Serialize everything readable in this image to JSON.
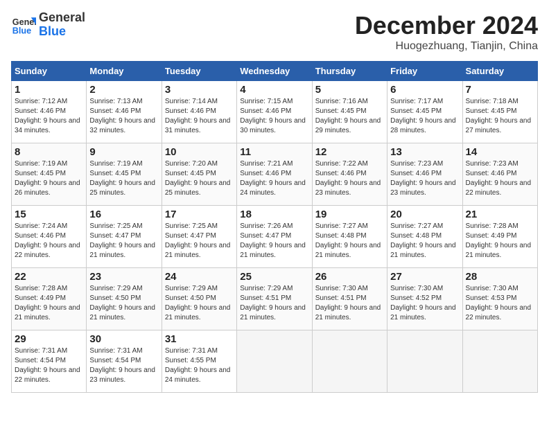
{
  "logo": {
    "line1": "General",
    "line2": "Blue"
  },
  "title": "December 2024",
  "location": "Huogezhuang, Tianjin, China",
  "days_of_week": [
    "Sunday",
    "Monday",
    "Tuesday",
    "Wednesday",
    "Thursday",
    "Friday",
    "Saturday"
  ],
  "weeks": [
    [
      {
        "day": "1",
        "sunrise": "7:12 AM",
        "sunset": "4:46 PM",
        "daylight": "9 hours and 34 minutes."
      },
      {
        "day": "2",
        "sunrise": "7:13 AM",
        "sunset": "4:46 PM",
        "daylight": "9 hours and 32 minutes."
      },
      {
        "day": "3",
        "sunrise": "7:14 AM",
        "sunset": "4:46 PM",
        "daylight": "9 hours and 31 minutes."
      },
      {
        "day": "4",
        "sunrise": "7:15 AM",
        "sunset": "4:46 PM",
        "daylight": "9 hours and 30 minutes."
      },
      {
        "day": "5",
        "sunrise": "7:16 AM",
        "sunset": "4:45 PM",
        "daylight": "9 hours and 29 minutes."
      },
      {
        "day": "6",
        "sunrise": "7:17 AM",
        "sunset": "4:45 PM",
        "daylight": "9 hours and 28 minutes."
      },
      {
        "day": "7",
        "sunrise": "7:18 AM",
        "sunset": "4:45 PM",
        "daylight": "9 hours and 27 minutes."
      }
    ],
    [
      {
        "day": "8",
        "sunrise": "7:19 AM",
        "sunset": "4:45 PM",
        "daylight": "9 hours and 26 minutes."
      },
      {
        "day": "9",
        "sunrise": "7:19 AM",
        "sunset": "4:45 PM",
        "daylight": "9 hours and 25 minutes."
      },
      {
        "day": "10",
        "sunrise": "7:20 AM",
        "sunset": "4:45 PM",
        "daylight": "9 hours and 25 minutes."
      },
      {
        "day": "11",
        "sunrise": "7:21 AM",
        "sunset": "4:46 PM",
        "daylight": "9 hours and 24 minutes."
      },
      {
        "day": "12",
        "sunrise": "7:22 AM",
        "sunset": "4:46 PM",
        "daylight": "9 hours and 23 minutes."
      },
      {
        "day": "13",
        "sunrise": "7:23 AM",
        "sunset": "4:46 PM",
        "daylight": "9 hours and 23 minutes."
      },
      {
        "day": "14",
        "sunrise": "7:23 AM",
        "sunset": "4:46 PM",
        "daylight": "9 hours and 22 minutes."
      }
    ],
    [
      {
        "day": "15",
        "sunrise": "7:24 AM",
        "sunset": "4:46 PM",
        "daylight": "9 hours and 22 minutes."
      },
      {
        "day": "16",
        "sunrise": "7:25 AM",
        "sunset": "4:47 PM",
        "daylight": "9 hours and 21 minutes."
      },
      {
        "day": "17",
        "sunrise": "7:25 AM",
        "sunset": "4:47 PM",
        "daylight": "9 hours and 21 minutes."
      },
      {
        "day": "18",
        "sunrise": "7:26 AM",
        "sunset": "4:47 PM",
        "daylight": "9 hours and 21 minutes."
      },
      {
        "day": "19",
        "sunrise": "7:27 AM",
        "sunset": "4:48 PM",
        "daylight": "9 hours and 21 minutes."
      },
      {
        "day": "20",
        "sunrise": "7:27 AM",
        "sunset": "4:48 PM",
        "daylight": "9 hours and 21 minutes."
      },
      {
        "day": "21",
        "sunrise": "7:28 AM",
        "sunset": "4:49 PM",
        "daylight": "9 hours and 21 minutes."
      }
    ],
    [
      {
        "day": "22",
        "sunrise": "7:28 AM",
        "sunset": "4:49 PM",
        "daylight": "9 hours and 21 minutes."
      },
      {
        "day": "23",
        "sunrise": "7:29 AM",
        "sunset": "4:50 PM",
        "daylight": "9 hours and 21 minutes."
      },
      {
        "day": "24",
        "sunrise": "7:29 AM",
        "sunset": "4:50 PM",
        "daylight": "9 hours and 21 minutes."
      },
      {
        "day": "25",
        "sunrise": "7:29 AM",
        "sunset": "4:51 PM",
        "daylight": "9 hours and 21 minutes."
      },
      {
        "day": "26",
        "sunrise": "7:30 AM",
        "sunset": "4:51 PM",
        "daylight": "9 hours and 21 minutes."
      },
      {
        "day": "27",
        "sunrise": "7:30 AM",
        "sunset": "4:52 PM",
        "daylight": "9 hours and 21 minutes."
      },
      {
        "day": "28",
        "sunrise": "7:30 AM",
        "sunset": "4:53 PM",
        "daylight": "9 hours and 22 minutes."
      }
    ],
    [
      {
        "day": "29",
        "sunrise": "7:31 AM",
        "sunset": "4:54 PM",
        "daylight": "9 hours and 22 minutes."
      },
      {
        "day": "30",
        "sunrise": "7:31 AM",
        "sunset": "4:54 PM",
        "daylight": "9 hours and 23 minutes."
      },
      {
        "day": "31",
        "sunrise": "7:31 AM",
        "sunset": "4:55 PM",
        "daylight": "9 hours and 24 minutes."
      },
      null,
      null,
      null,
      null
    ]
  ]
}
